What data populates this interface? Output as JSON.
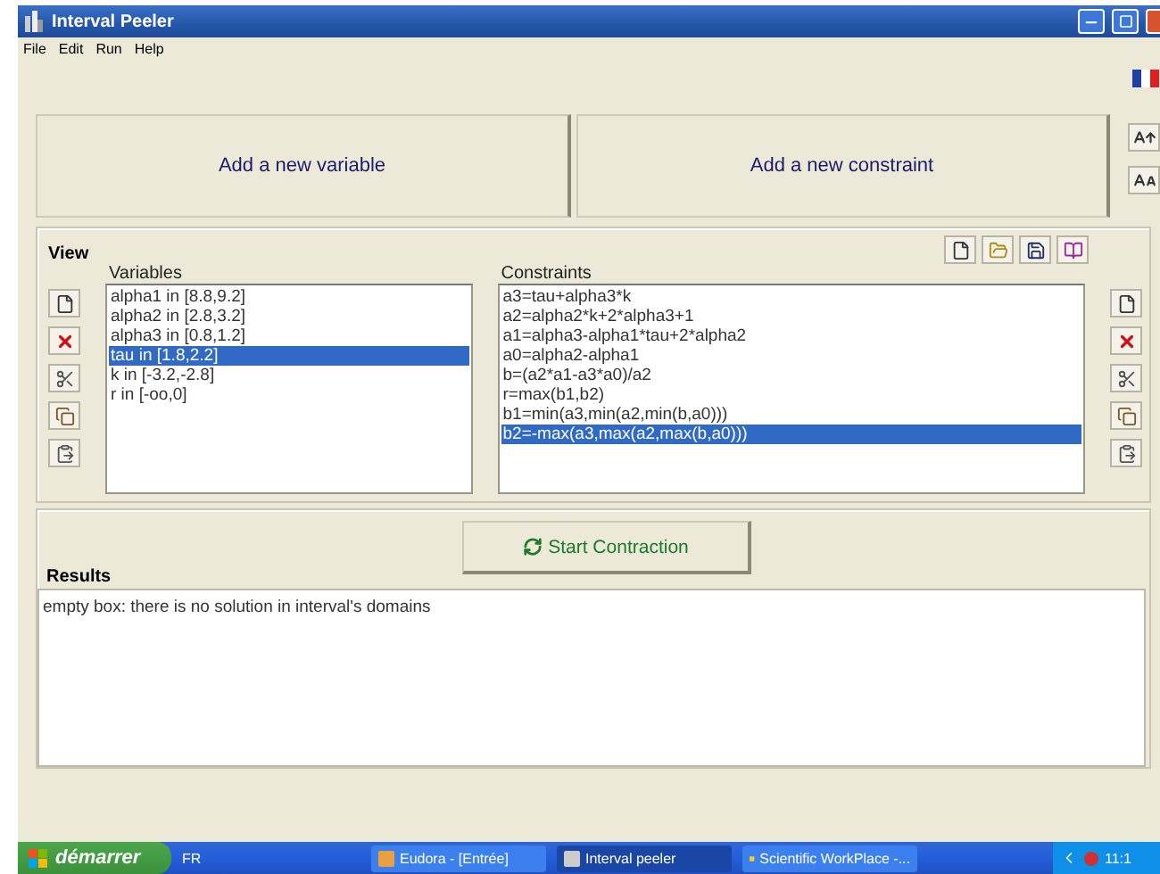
{
  "window": {
    "title": "Interval Peeler"
  },
  "menu": [
    "File",
    "Edit",
    "Run",
    "Help"
  ],
  "actions": [
    "Add a new variable",
    "Add a new constraint"
  ],
  "view": {
    "title": "View",
    "variables": {
      "label": "Variables",
      "items": [
        {
          "text": "alpha1 in [8.8,9.2]",
          "selected": false
        },
        {
          "text": "alpha2 in [2.8,3.2]",
          "selected": false
        },
        {
          "text": "alpha3 in [0.8,1.2]",
          "selected": false
        },
        {
          "text": "tau in [1.8,2.2]",
          "selected": true
        },
        {
          "text": "k in [-3.2,-2.8]",
          "selected": false
        },
        {
          "text": "r in [-oo,0]",
          "selected": false
        }
      ]
    },
    "constraints": {
      "label": "Constraints",
      "items": [
        {
          "text": "a3=tau+alpha3*k",
          "selected": false
        },
        {
          "text": "a2=alpha2*k+2*alpha3+1",
          "selected": false
        },
        {
          "text": "a1=alpha3-alpha1*tau+2*alpha2",
          "selected": false
        },
        {
          "text": "a0=alpha2-alpha1",
          "selected": false
        },
        {
          "text": "b=(a2*a1-a3*a0)/a2",
          "selected": false
        },
        {
          "text": "r=max(b1,b2)",
          "selected": false
        },
        {
          "text": "b1=min(a3,min(a2,min(b,a0)))",
          "selected": false
        },
        {
          "text": "b2=-max(a3,max(a2,max(b,a0)))",
          "selected": true
        }
      ]
    }
  },
  "run_button": "Start Contraction",
  "results": {
    "label": "Results",
    "text": "empty box: there is no solution in interval's domains"
  },
  "taskbar": {
    "start": "démarrer",
    "language": "FR",
    "tasks": [
      {
        "label": "Eudora - [Entrée]",
        "selected": false
      },
      {
        "label": "Interval peeler",
        "selected": true
      },
      {
        "label": "Scientific WorkPlace -...",
        "selected": false
      }
    ],
    "clock": "11:1"
  }
}
